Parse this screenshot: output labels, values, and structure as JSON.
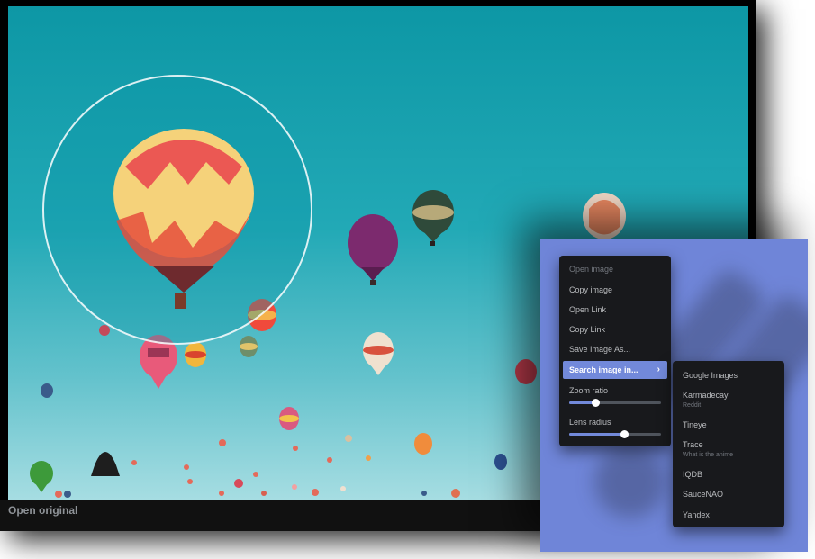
{
  "viewer": {
    "open_original": "Open original"
  },
  "context_menu": {
    "items": [
      {
        "label": "Open image",
        "state": "disabled"
      },
      {
        "label": "Copy image",
        "state": "normal"
      },
      {
        "label": "Open Link",
        "state": "normal"
      },
      {
        "label": "Copy Link",
        "state": "normal"
      },
      {
        "label": "Save Image As...",
        "state": "normal"
      },
      {
        "label": "Search image in...",
        "state": "active",
        "icon": "chevron-right-icon",
        "arrow": "›"
      }
    ],
    "sliders": [
      {
        "label": "Zoom ratio",
        "value": 0.28
      },
      {
        "label": "Lens radius",
        "value": 0.6
      }
    ]
  },
  "search_submenu": {
    "items": [
      {
        "label": "Google Images",
        "hint": ""
      },
      {
        "label": "Karmadecay",
        "hint": "Reddit"
      },
      {
        "label": "Tineye",
        "hint": ""
      },
      {
        "label": "Trace",
        "hint": "What is the anime"
      },
      {
        "label": "IQDB",
        "hint": ""
      },
      {
        "label": "SauceNAO",
        "hint": ""
      },
      {
        "label": "Yandex",
        "hint": ""
      }
    ]
  },
  "colors": {
    "sky_top": "#0d97a5",
    "sky_bottom": "#a6dde2",
    "menu_bg": "#18191c",
    "menu_accent": "#7289da",
    "panel_bg": "#6f85d8"
  }
}
